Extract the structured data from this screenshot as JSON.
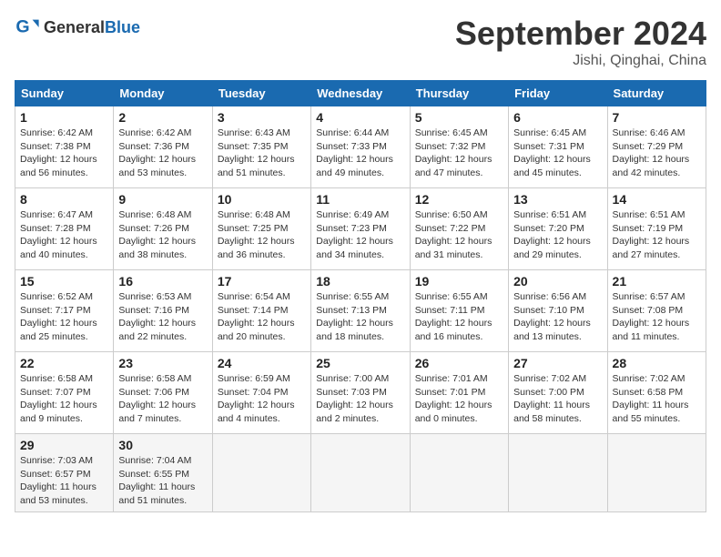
{
  "header": {
    "logo_general": "General",
    "logo_blue": "Blue",
    "title": "September 2024",
    "location": "Jishi, Qinghai, China"
  },
  "weekdays": [
    "Sunday",
    "Monday",
    "Tuesday",
    "Wednesday",
    "Thursday",
    "Friday",
    "Saturday"
  ],
  "weeks": [
    [
      {
        "day": "1",
        "sunrise": "6:42 AM",
        "sunset": "7:38 PM",
        "daylight": "12 hours and 56 minutes."
      },
      {
        "day": "2",
        "sunrise": "6:42 AM",
        "sunset": "7:36 PM",
        "daylight": "12 hours and 53 minutes."
      },
      {
        "day": "3",
        "sunrise": "6:43 AM",
        "sunset": "7:35 PM",
        "daylight": "12 hours and 51 minutes."
      },
      {
        "day": "4",
        "sunrise": "6:44 AM",
        "sunset": "7:33 PM",
        "daylight": "12 hours and 49 minutes."
      },
      {
        "day": "5",
        "sunrise": "6:45 AM",
        "sunset": "7:32 PM",
        "daylight": "12 hours and 47 minutes."
      },
      {
        "day": "6",
        "sunrise": "6:45 AM",
        "sunset": "7:31 PM",
        "daylight": "12 hours and 45 minutes."
      },
      {
        "day": "7",
        "sunrise": "6:46 AM",
        "sunset": "7:29 PM",
        "daylight": "12 hours and 42 minutes."
      }
    ],
    [
      {
        "day": "8",
        "sunrise": "6:47 AM",
        "sunset": "7:28 PM",
        "daylight": "12 hours and 40 minutes."
      },
      {
        "day": "9",
        "sunrise": "6:48 AM",
        "sunset": "7:26 PM",
        "daylight": "12 hours and 38 minutes."
      },
      {
        "day": "10",
        "sunrise": "6:48 AM",
        "sunset": "7:25 PM",
        "daylight": "12 hours and 36 minutes."
      },
      {
        "day": "11",
        "sunrise": "6:49 AM",
        "sunset": "7:23 PM",
        "daylight": "12 hours and 34 minutes."
      },
      {
        "day": "12",
        "sunrise": "6:50 AM",
        "sunset": "7:22 PM",
        "daylight": "12 hours and 31 minutes."
      },
      {
        "day": "13",
        "sunrise": "6:51 AM",
        "sunset": "7:20 PM",
        "daylight": "12 hours and 29 minutes."
      },
      {
        "day": "14",
        "sunrise": "6:51 AM",
        "sunset": "7:19 PM",
        "daylight": "12 hours and 27 minutes."
      }
    ],
    [
      {
        "day": "15",
        "sunrise": "6:52 AM",
        "sunset": "7:17 PM",
        "daylight": "12 hours and 25 minutes."
      },
      {
        "day": "16",
        "sunrise": "6:53 AM",
        "sunset": "7:16 PM",
        "daylight": "12 hours and 22 minutes."
      },
      {
        "day": "17",
        "sunrise": "6:54 AM",
        "sunset": "7:14 PM",
        "daylight": "12 hours and 20 minutes."
      },
      {
        "day": "18",
        "sunrise": "6:55 AM",
        "sunset": "7:13 PM",
        "daylight": "12 hours and 18 minutes."
      },
      {
        "day": "19",
        "sunrise": "6:55 AM",
        "sunset": "7:11 PM",
        "daylight": "12 hours and 16 minutes."
      },
      {
        "day": "20",
        "sunrise": "6:56 AM",
        "sunset": "7:10 PM",
        "daylight": "12 hours and 13 minutes."
      },
      {
        "day": "21",
        "sunrise": "6:57 AM",
        "sunset": "7:08 PM",
        "daylight": "12 hours and 11 minutes."
      }
    ],
    [
      {
        "day": "22",
        "sunrise": "6:58 AM",
        "sunset": "7:07 PM",
        "daylight": "12 hours and 9 minutes."
      },
      {
        "day": "23",
        "sunrise": "6:58 AM",
        "sunset": "7:06 PM",
        "daylight": "12 hours and 7 minutes."
      },
      {
        "day": "24",
        "sunrise": "6:59 AM",
        "sunset": "7:04 PM",
        "daylight": "12 hours and 4 minutes."
      },
      {
        "day": "25",
        "sunrise": "7:00 AM",
        "sunset": "7:03 PM",
        "daylight": "12 hours and 2 minutes."
      },
      {
        "day": "26",
        "sunrise": "7:01 AM",
        "sunset": "7:01 PM",
        "daylight": "12 hours and 0 minutes."
      },
      {
        "day": "27",
        "sunrise": "7:02 AM",
        "sunset": "7:00 PM",
        "daylight": "11 hours and 58 minutes."
      },
      {
        "day": "28",
        "sunrise": "7:02 AM",
        "sunset": "6:58 PM",
        "daylight": "11 hours and 55 minutes."
      }
    ],
    [
      {
        "day": "29",
        "sunrise": "7:03 AM",
        "sunset": "6:57 PM",
        "daylight": "11 hours and 53 minutes."
      },
      {
        "day": "30",
        "sunrise": "7:04 AM",
        "sunset": "6:55 PM",
        "daylight": "11 hours and 51 minutes."
      },
      null,
      null,
      null,
      null,
      null
    ]
  ]
}
